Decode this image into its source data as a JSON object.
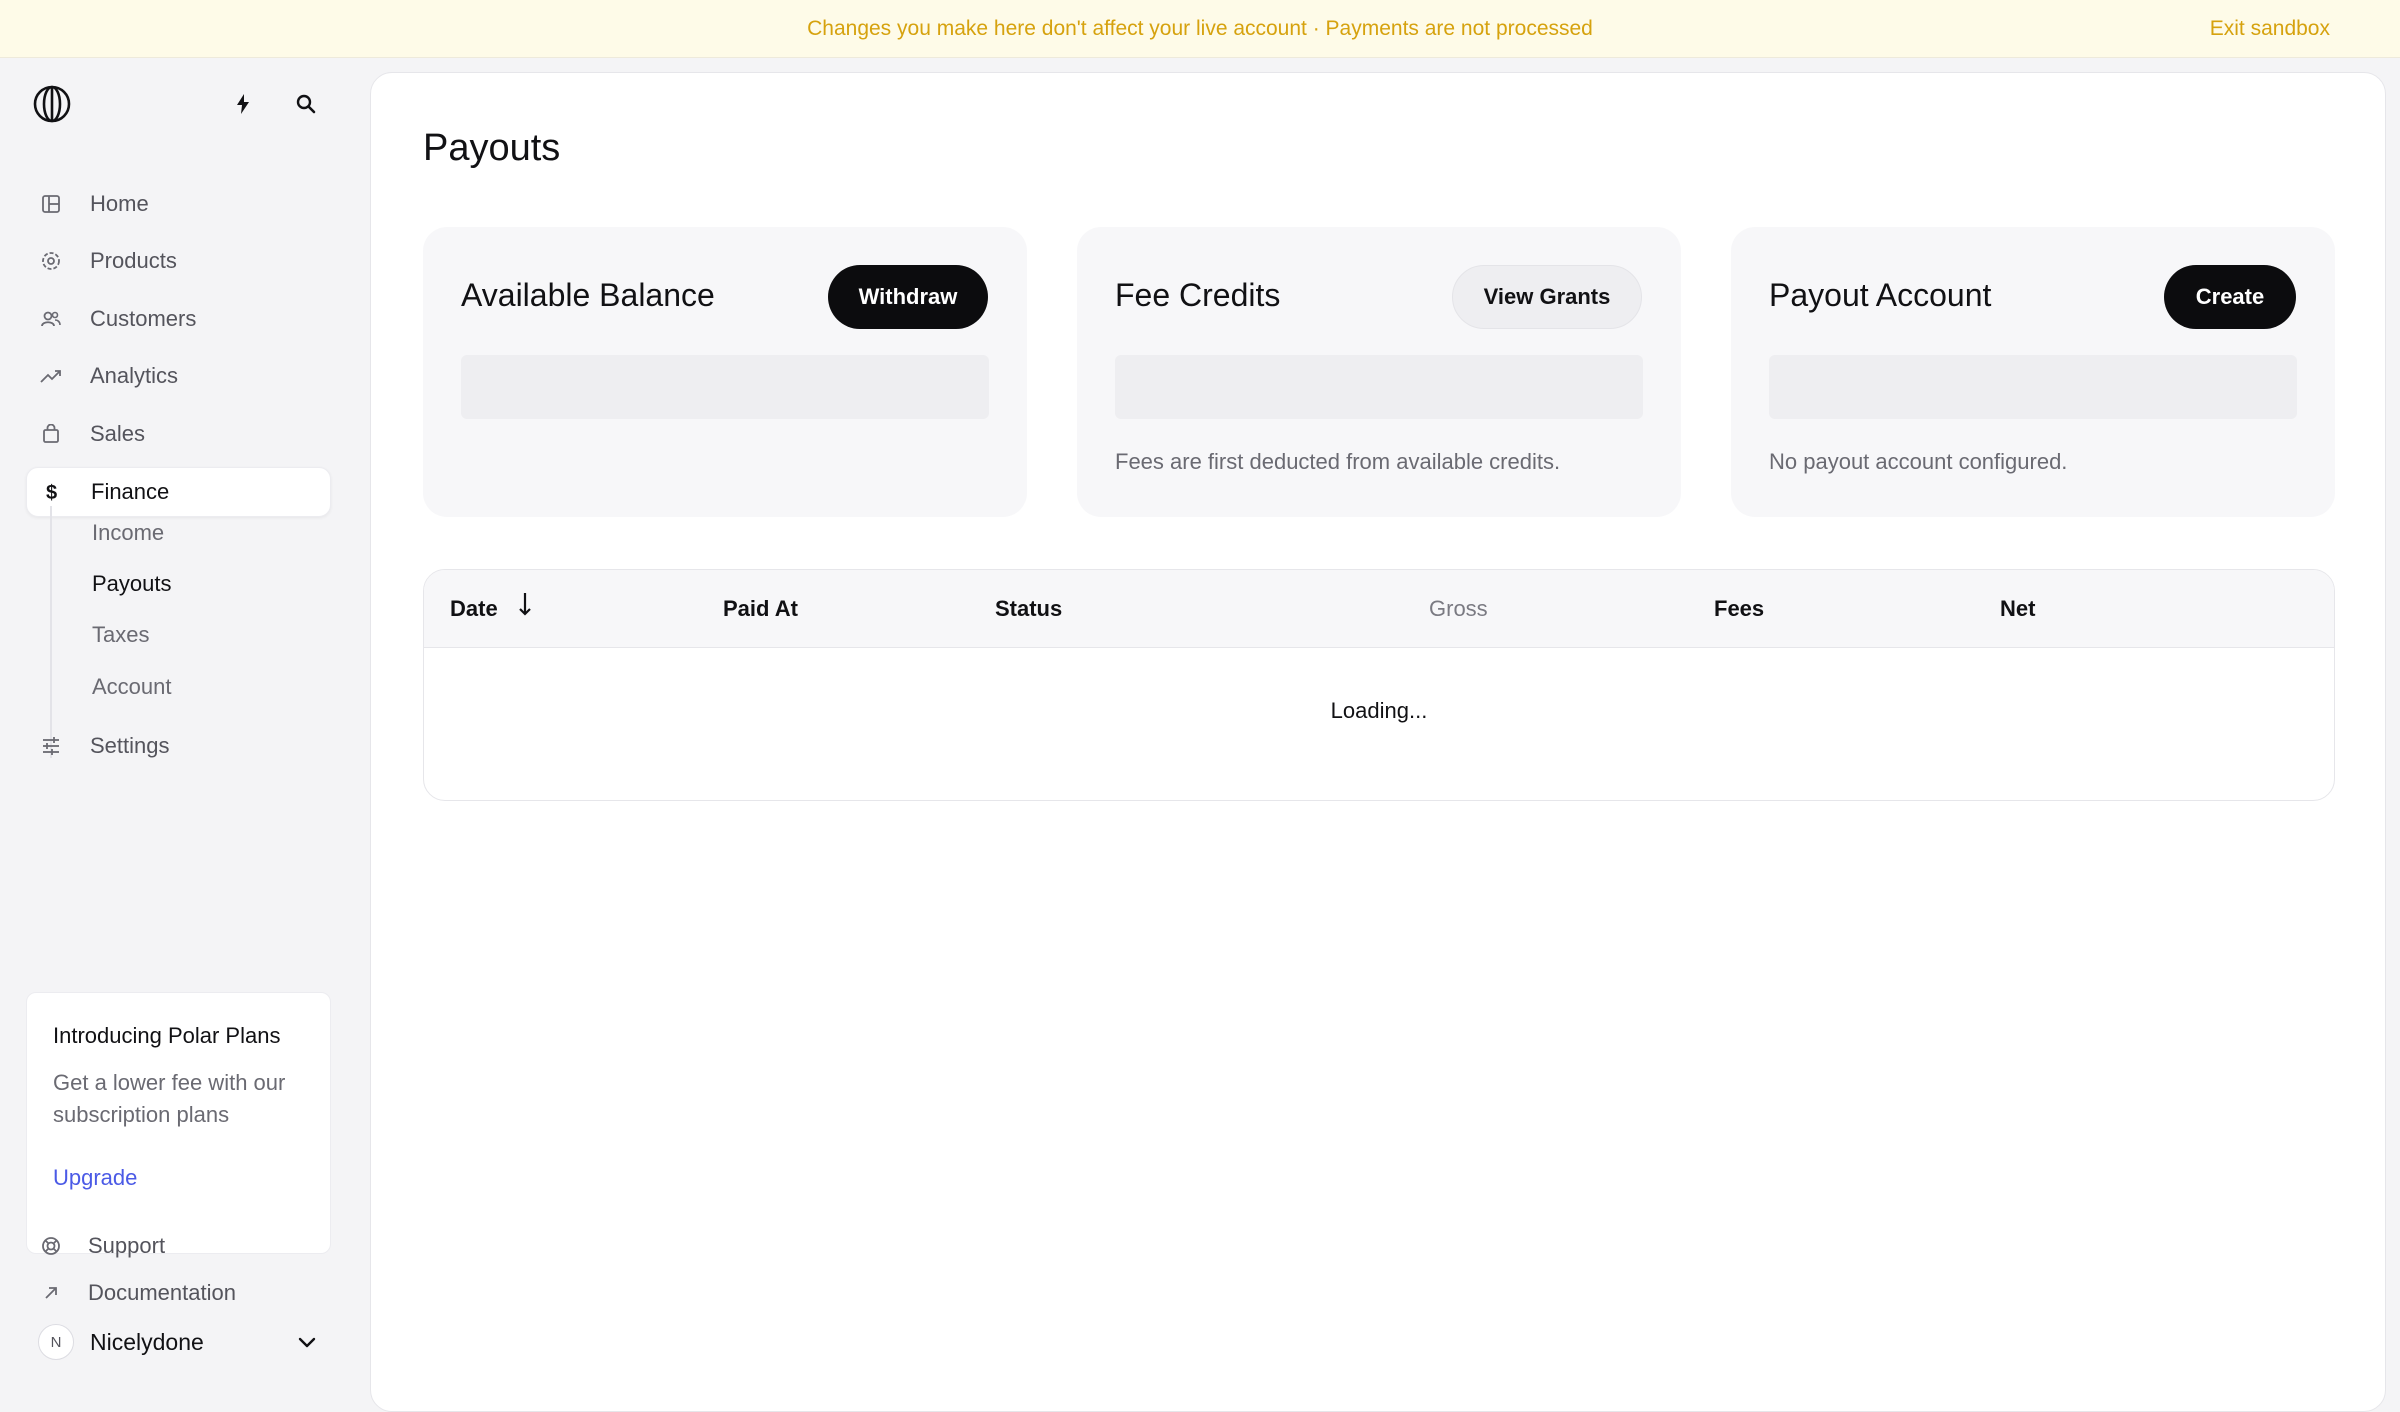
{
  "banner": {
    "message": "Changes you make here don't affect your live account · Payments are not processed",
    "exit_label": "Exit sandbox"
  },
  "sidebar": {
    "nav": [
      {
        "label": "Home",
        "icon": "home-icon"
      },
      {
        "label": "Products",
        "icon": "products-icon"
      },
      {
        "label": "Customers",
        "icon": "customers-icon"
      },
      {
        "label": "Analytics",
        "icon": "analytics-icon"
      },
      {
        "label": "Sales",
        "icon": "sales-icon"
      },
      {
        "label": "Finance",
        "icon": "dollar-icon"
      },
      {
        "label": "Settings",
        "icon": "settings-icon"
      }
    ],
    "finance_sub": [
      {
        "label": "Income"
      },
      {
        "label": "Payouts"
      },
      {
        "label": "Taxes"
      },
      {
        "label": "Account"
      }
    ],
    "active_item": "Finance",
    "active_sub_item": "Payouts",
    "promo": {
      "title": "Introducing Polar Plans",
      "text": "Get a lower fee with our subscription plans",
      "link": "Upgrade"
    },
    "footer_links": [
      {
        "label": "Support",
        "icon": "support-icon"
      },
      {
        "label": "Documentation",
        "icon": "arrow-up-right-icon"
      }
    ],
    "account": {
      "initial": "N",
      "name": "Nicelydone"
    }
  },
  "main": {
    "title": "Payouts",
    "cards": [
      {
        "title": "Available Balance",
        "button": "Withdraw",
        "note": ""
      },
      {
        "title": "Fee Credits",
        "button": "View Grants",
        "note": "Fees are first deducted from available credits."
      },
      {
        "title": "Payout Account",
        "button": "Create",
        "note": "No payout account configured."
      }
    ],
    "table": {
      "columns": [
        "Date",
        "Paid At",
        "Status",
        "Gross",
        "Fees",
        "Net"
      ],
      "loading_text": "Loading..."
    }
  },
  "colors": {
    "banner_bg": "#fefbe8",
    "banner_text": "#d6a20e",
    "link": "#4b5ae6",
    "button_dark": "#0c0c0e"
  }
}
